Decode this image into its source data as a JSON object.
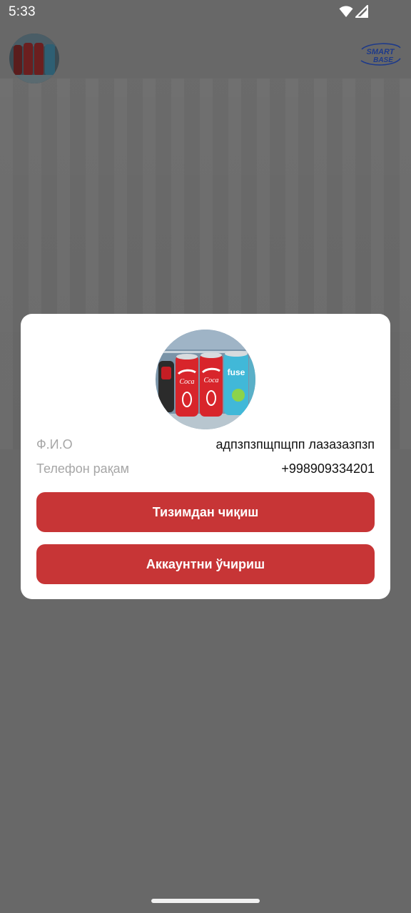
{
  "status_bar": {
    "time": "5:33",
    "icons": [
      "wifi-icon",
      "signal-icon"
    ]
  },
  "header": {
    "logo_text_top": "SMART",
    "logo_text_bottom": "BASE",
    "avatar_icon": "profile-photo-cans"
  },
  "profile_dialog": {
    "fields": [
      {
        "label": "Ф.И.О",
        "value": "адпзпзпщпщпп лазазазпзп"
      },
      {
        "label": "Телефон рақам",
        "value": "+998909334201"
      }
    ],
    "logout_label": "Тизимдан чиқиш",
    "delete_account_label": "Аккаунтни ўчириш"
  },
  "colors": {
    "overlay": "#686868",
    "accent_button": "#c73536",
    "label_text": "#a6a6a6",
    "logo_red": "#d32f2f",
    "logo_blue": "#1e3a8a"
  }
}
